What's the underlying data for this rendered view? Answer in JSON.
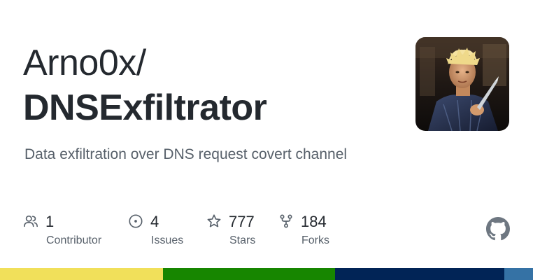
{
  "repo": {
    "owner": "Arno0x/",
    "name": "DNSExfiltrator",
    "description": "Data exfiltration over DNS request covert channel"
  },
  "stats": {
    "contributors": {
      "value": "1",
      "label": "Contributor",
      "icon": "people-icon"
    },
    "issues": {
      "value": "4",
      "label": "Issues",
      "icon": "issue-opened-icon"
    },
    "stars": {
      "value": "777",
      "label": "Stars",
      "icon": "star-icon"
    },
    "forks": {
      "value": "184",
      "label": "Forks",
      "icon": "repo-forked-icon"
    }
  },
  "branding": {
    "logo_icon": "github-mark-icon",
    "avatar_icon": "user-avatar-photo"
  },
  "language_bar": [
    {
      "color": "#f1e05a",
      "share": 0.306
    },
    {
      "color": "#178600",
      "share": 0.322
    },
    {
      "color": "#012456",
      "share": 0.318
    },
    {
      "color": "#3572a5",
      "share": 0.054
    }
  ],
  "colors": {
    "text_primary": "#24292f",
    "text_secondary": "#57606a",
    "icon": "#57606a"
  }
}
